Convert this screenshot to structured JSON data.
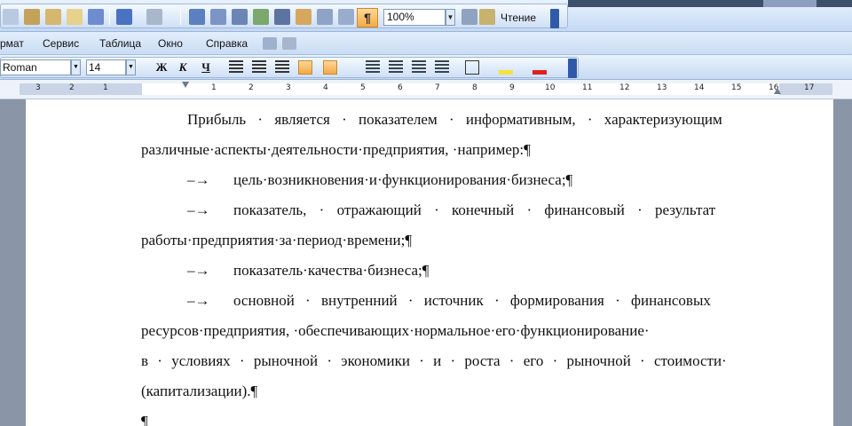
{
  "toolbar": {
    "zoom_value": "100%",
    "read_label": "Чтение",
    "show_marks": "¶"
  },
  "menu": [
    {
      "label": "рмат"
    },
    {
      "label": "Сервис"
    },
    {
      "label": "Таблица"
    },
    {
      "label": "Окно"
    },
    {
      "label": "Справка"
    }
  ],
  "format": {
    "font_name": "Roman",
    "font_size": "14",
    "bold": "Ж",
    "italic": "К",
    "underline": "Ч"
  },
  "ruler": {
    "numbers": [
      "1",
      "2",
      "3",
      "4",
      "5",
      "6",
      "7",
      "8",
      "9",
      "10",
      "11",
      "12",
      "13",
      "14",
      "15",
      "16",
      "17"
    ],
    "left_numbers": [
      "3",
      "2",
      "1"
    ]
  },
  "document": {
    "p1_line1": "Прибыль · является · показателем · информативным, · характеризующим",
    "p1_line2": "различные·аспекты·деятельности·предприятия, ·например:¶",
    "b1_dash": "–→",
    "b1_text": "цель·возникновения·и·функционирования·бизнеса;¶",
    "b2_dash": "–→",
    "b2_line1": "показатель, · отражающий · конечный · финансовый · результат",
    "b2_line2": "работы·предприятия·за·период·времени;¶",
    "b3_dash": "–→",
    "b3_text": "показатель·качества·бизнеса;¶",
    "b4_dash": "–→",
    "b4_line1": "основной · внутренний · источник · формирования · финансовых",
    "b4_line2": "ресурсов·предприятия, ·обеспечивающих·нормальное·его·функционирование·",
    "b4_line3": "в · условиях · рыночной · экономики · и · роста · его · рыночной · стоимости·",
    "b4_line4": "(капитализации).¶",
    "empty_mark": "¶"
  }
}
